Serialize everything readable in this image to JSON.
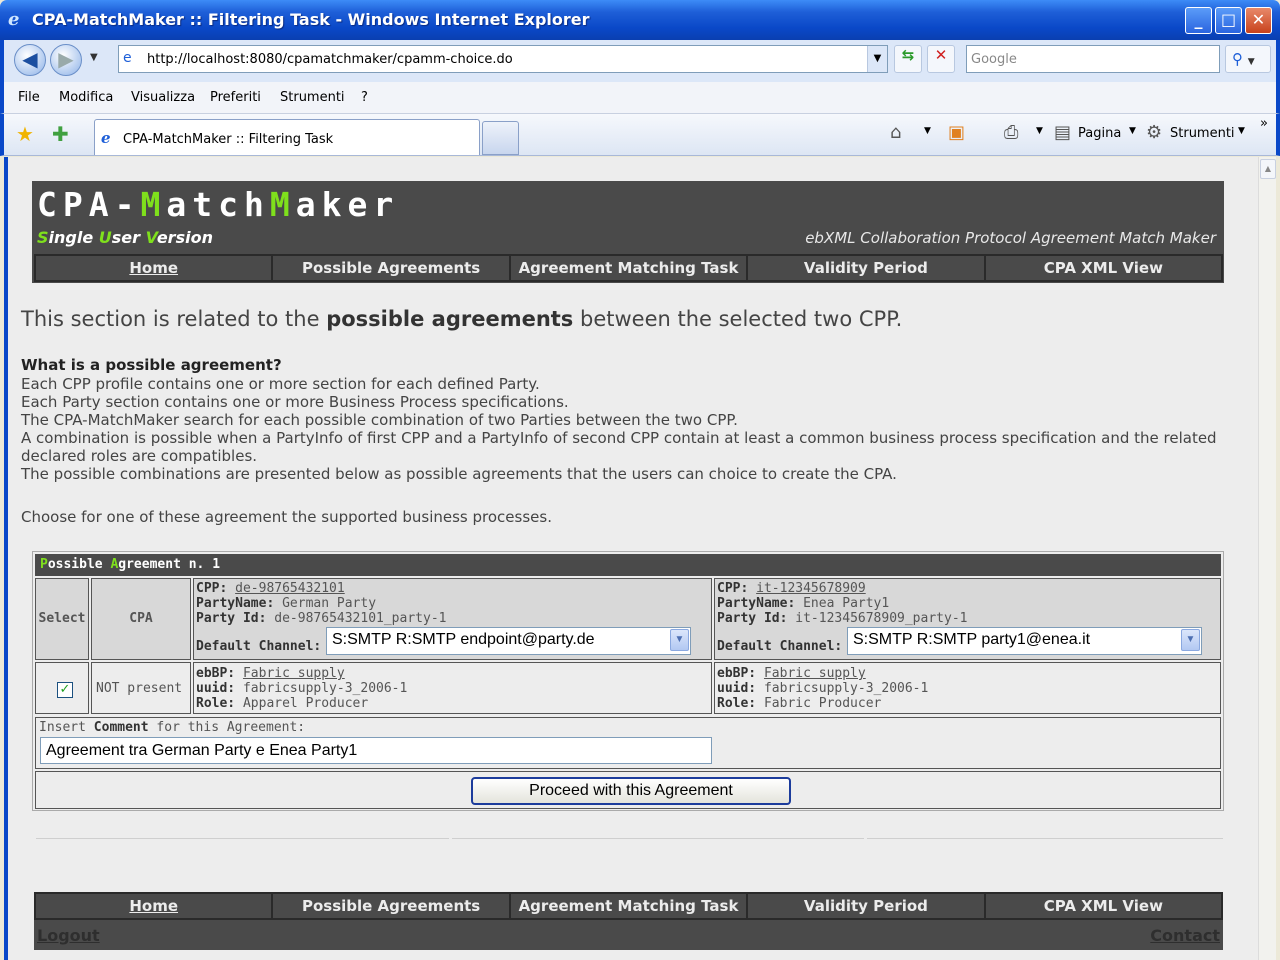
{
  "window": {
    "title": "CPA-MatchMaker :: Filtering Task - Windows Internet Explorer"
  },
  "browser": {
    "url": "http://localhost:8080/cpamatchmaker/cpamm-choice.do",
    "search_placeholder": "Google",
    "menu": [
      "File",
      "Modifica",
      "Visualizza",
      "Preferiti",
      "Strumenti",
      "?"
    ],
    "tab_title": "CPA-MatchMaker :: Filtering Task",
    "page_label": "Pagina",
    "tools_label": "Strumenti"
  },
  "site": {
    "logo_parts": [
      "CPA-",
      "M",
      "atch",
      "M",
      "aker"
    ],
    "subtitle_parts": [
      "S",
      "ingle ",
      "U",
      "ser ",
      "V",
      "ersion"
    ],
    "tagline": "ebXML Collaboration Protocol Agreement Match Maker",
    "nav": [
      "Home",
      "Possible Agreements",
      "Agreement Matching Task",
      "Validity Period",
      "CPA XML View"
    ]
  },
  "intro": {
    "heading_pre": "This section is related to the ",
    "heading_bold": "possible agreements",
    "heading_post": " between the selected two CPP.",
    "question": "What is a possible agreement?",
    "lines": [
      "Each CPP profile contains one or more section for each defined Party.",
      "Each Party section contains one or more Business Process specifications.",
      "The CPA-MatchMaker search for each possible combination of two Parties between the two CPP.",
      "A combination is possible when a PartyInfo of first CPP and a PartyInfo of second CPP contain at least a common business process specification and the related declared roles are compatibles.",
      "The possible combinations are presented below as possible agreements that the users can choice to create the CPA."
    ],
    "choose": "Choose for one of these agreement the supported business processes."
  },
  "agreement": {
    "title_parts": [
      "P",
      "ossible ",
      "A",
      "greement n. 1"
    ],
    "select_header": "Select",
    "cpa_header": "CPA",
    "selected": true,
    "cpa_status": "NOT present",
    "cpp_label": "CPP:",
    "party_name_label": "PartyName:",
    "party_id_label": "Party Id:",
    "channel_label": "Default Channel:",
    "ebbp_label": "ebBP:",
    "uuid_label": "uuid:",
    "role_label": "Role:",
    "left": {
      "cpp": "de-98765432101",
      "party_name": "German Party",
      "party_id": "de-98765432101_party-1",
      "channel": "S:SMTP R:SMTP endpoint@party.de",
      "ebbp": "Fabric supply",
      "uuid": "fabricsupply-3_2006-1",
      "role": "Apparel Producer"
    },
    "right": {
      "cpp": "it-12345678909",
      "party_name": "Enea Party1",
      "party_id": "it-12345678909_party-1",
      "channel": "S:SMTP R:SMTP party1@enea.it",
      "ebbp": "Fabric supply",
      "uuid": "fabricsupply-3_2006-1",
      "role": "Fabric Producer"
    },
    "comment_label_pre": "Insert ",
    "comment_label_bold": "Comment",
    "comment_label_post": " for this Agreement:",
    "comment_value": "Agreement tra German Party e Enea Party1",
    "proceed_label": "Proceed with this Agreement"
  },
  "footer": {
    "logout": "Logout",
    "contact": "Contact"
  }
}
